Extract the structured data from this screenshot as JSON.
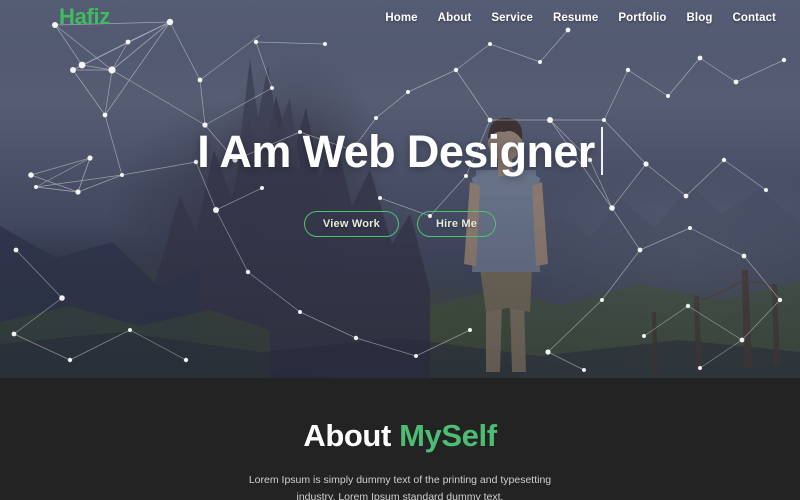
{
  "brand": {
    "logo_text": "Hafiz",
    "logo_color": "#3ebc5f"
  },
  "nav": {
    "items": [
      {
        "label": "Home",
        "name": "nav-item-home"
      },
      {
        "label": "About",
        "name": "nav-item-about"
      },
      {
        "label": "Service",
        "name": "nav-item-service"
      },
      {
        "label": "Resume",
        "name": "nav-item-resume"
      },
      {
        "label": "Portfolio",
        "name": "nav-item-portfolio"
      },
      {
        "label": "Blog",
        "name": "nav-item-blog"
      },
      {
        "label": "Contact",
        "name": "nav-item-contact"
      }
    ]
  },
  "hero": {
    "title": "I Am Web Designer",
    "buttons": [
      {
        "label": "View Work",
        "name": "view-work-button"
      },
      {
        "label": "Hire Me",
        "name": "hire-me-button"
      }
    ],
    "background_description": "mountain-landscape-hiker-photo",
    "overlay": "particle-network-overlay",
    "accent_color": "#4fc26e"
  },
  "about": {
    "title_plain": "About ",
    "title_accent": "MySelf",
    "accent_color": "#4cbd72",
    "paragraph": "Lorem Ipsum is simply dummy text of the printing and typesetting industry. Lorem Ipsum standard dummy text.",
    "background_color": "#232323"
  }
}
